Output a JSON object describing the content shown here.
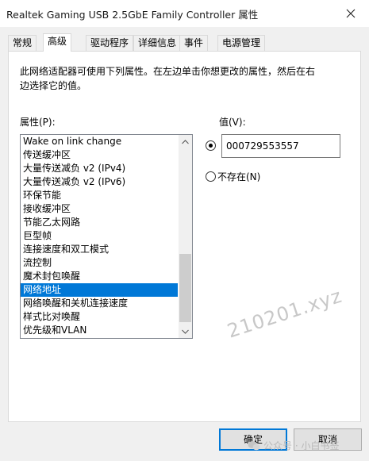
{
  "window": {
    "title": "Realtek Gaming USB 2.5GbE Family Controller 属性",
    "close_icon": "close-icon"
  },
  "tabs": [
    {
      "label": "常规",
      "active": false
    },
    {
      "label": "高级",
      "active": true
    },
    {
      "label": "驱动程序",
      "active": false
    },
    {
      "label": "详细信息",
      "active": false
    },
    {
      "label": "事件",
      "active": false
    },
    {
      "label": "电源管理",
      "active": false
    }
  ],
  "panel": {
    "description": "此网络适配器可使用下列属性。在左边单击你想更改的属性，然后在右边选择它的值。",
    "property_label": "属性(P):",
    "value_label": "值(V):",
    "properties": [
      "Wake on link change",
      "传送缓冲区",
      "大量传送减负 v2 (IPv4)",
      "大量传送减负 v2 (IPv6)",
      "环保节能",
      "接收缓冲区",
      "节能乙太网路",
      "巨型帧",
      "连接速度和双工模式",
      "流控制",
      "魔术封包唤醒",
      "网络地址",
      "网络唤醒和关机连接速度",
      "样式比对唤醒",
      "优先级和VLAN"
    ],
    "selected_property": "网络地址",
    "value_input": "000729553557",
    "value_radio_checked": true,
    "not_present_label": "不存在(N)",
    "not_present_checked": false
  },
  "watermark": "210201.xyz",
  "buttons": {
    "ok": "确定",
    "cancel": "取消"
  },
  "footer_watermark": "公众号 · 小白书签",
  "colors": {
    "selection": "#0078d7",
    "panel_background": "#ffffff",
    "dialog_background": "#f0f0f0"
  }
}
